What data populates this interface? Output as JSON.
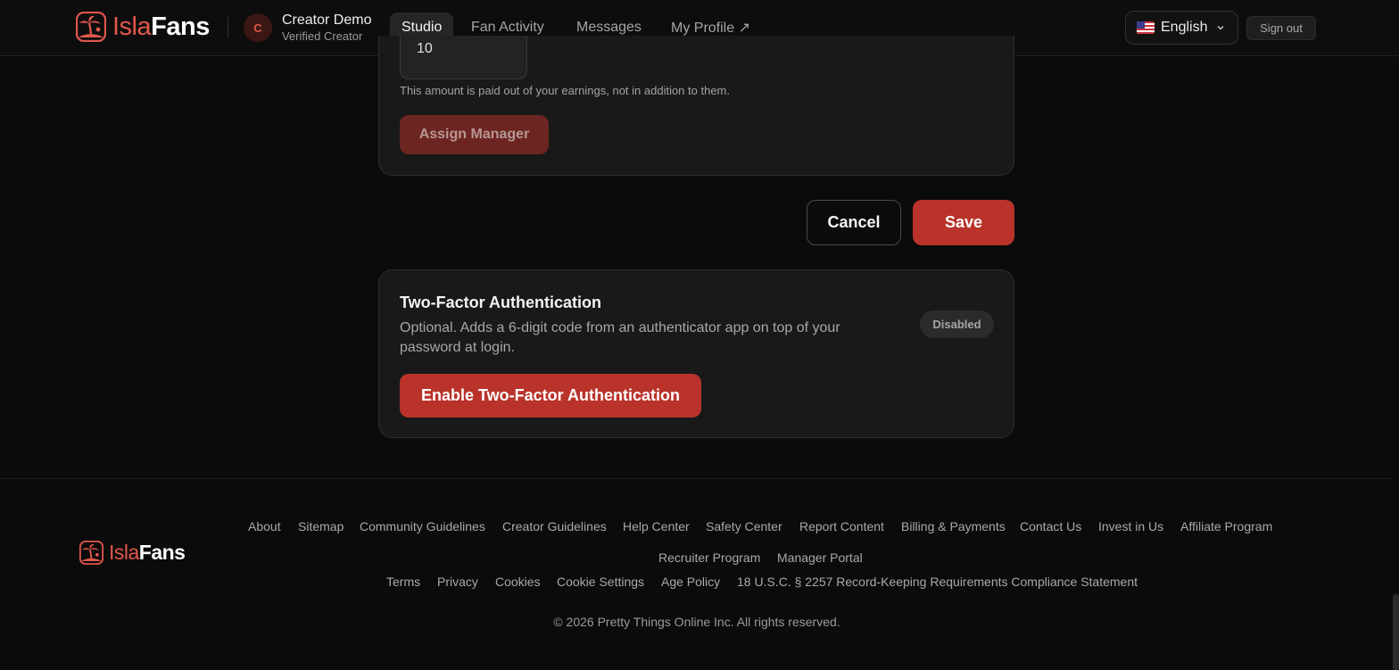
{
  "brand": {
    "name_part1": "Isla",
    "name_part2": "Fans"
  },
  "header": {
    "avatar_initial": "C",
    "user_name": "Creator Demo",
    "user_role": "Verified Creator",
    "nav": [
      {
        "label": "Studio",
        "active": true
      },
      {
        "label": "Fan Activity",
        "active": false
      },
      {
        "label": "Messages",
        "active": false
      },
      {
        "label": "My Profile ↗",
        "active": false
      }
    ],
    "language": "English",
    "flag_icon": "us-flag-icon",
    "sign_out": "Sign out"
  },
  "manager": {
    "percent_value": "10",
    "hint": "This amount is paid out of your earnings, not in addition to them.",
    "assign_button": "Assign Manager"
  },
  "actions": {
    "cancel": "Cancel",
    "save": "Save"
  },
  "two_factor": {
    "title": "Two-Factor Authentication",
    "description": "Optional. Adds a 6-digit code from an authenticator app on top of your password at login.",
    "status": "Disabled",
    "enable_button": "Enable Two-Factor Authentication"
  },
  "footer": {
    "links_row1": [
      "About",
      "Sitemap",
      "Community Guidelines",
      "Creator Guidelines",
      "Help Center",
      "Safety Center",
      "Report Content",
      "Billing & Payments",
      "Contact Us",
      "Invest in Us",
      "Affiliate Program"
    ],
    "links_row2": [
      "Recruiter Program",
      "Manager Portal"
    ],
    "legal_links": [
      "Terms",
      "Privacy",
      "Cookies",
      "Cookie Settings",
      "Age Policy",
      "18 U.S.C. § 2257 Record-Keeping Requirements Compliance Statement"
    ],
    "copyright": "© 2026 Pretty Things Online Inc. All rights reserved."
  },
  "colors": {
    "accent": "#b9332b",
    "brand_coral": "#e2574c",
    "background": "#0b0b0b",
    "card": "#191919"
  }
}
